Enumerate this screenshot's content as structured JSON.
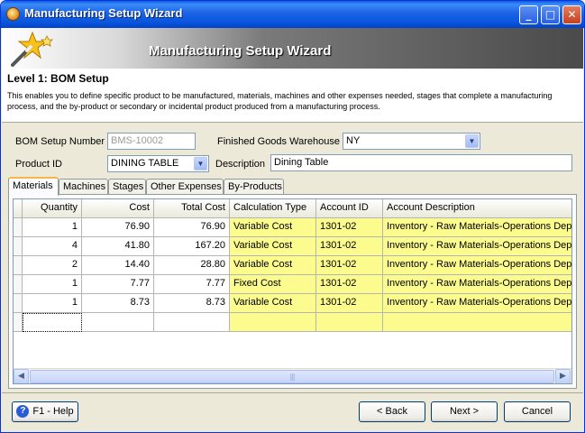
{
  "window": {
    "title": "Manufacturing Setup Wizard",
    "minimize": "_",
    "maximize": "□",
    "close": "✕"
  },
  "banner": {
    "title": "Manufacturing Setup Wizard",
    "icon": "magic-wand-icon"
  },
  "header": {
    "level_title": "Level 1: BOM Setup",
    "description": "This enables you to define specific product to be manufactured, materials, machines and other expenses needed, stages that complete a manufacturing process, and the by-product or secondary or incidental product produced from a manufacturing process."
  },
  "form": {
    "bom_setup_number_label": "BOM Setup Number",
    "bom_setup_number_value": "BMS-10002",
    "finished_goods_warehouse_label": "Finished Goods Warehouse",
    "finished_goods_warehouse_value": "NY",
    "product_id_label": "Product ID",
    "product_id_value": "DINING TABLE",
    "description_label": "Description",
    "description_value": "Dining Table"
  },
  "tabs": [
    {
      "label": "Materials",
      "active": true
    },
    {
      "label": "Machines"
    },
    {
      "label": "Stages"
    },
    {
      "label": "Other Expenses"
    },
    {
      "label": "By-Products"
    }
  ],
  "grid": {
    "columns": [
      "Quantity",
      "Cost",
      "Total Cost",
      "Calculation Type",
      "Account ID",
      "Account Description"
    ],
    "rows": [
      [
        "1",
        "76.90",
        "76.90",
        "Variable Cost",
        "1301-02",
        "Inventory - Raw Materials-Operations Depa"
      ],
      [
        "4",
        "41.80",
        "167.20",
        "Variable Cost",
        "1301-02",
        "Inventory - Raw Materials-Operations Depa"
      ],
      [
        "2",
        "14.40",
        "28.80",
        "Variable Cost",
        "1301-02",
        "Inventory - Raw Materials-Operations Depa"
      ],
      [
        "1",
        "7.77",
        "7.77",
        "Fixed Cost",
        "1301-02",
        "Inventory - Raw Materials-Operations Depa"
      ],
      [
        "1",
        "8.73",
        "8.73",
        "Variable Cost",
        "1301-02",
        "Inventory - Raw Materials-Operations Depa"
      ]
    ],
    "highlight_color": "#fbfb8e"
  },
  "buttons": {
    "help": "F1 - Help",
    "back": "< Back",
    "next": "Next >",
    "cancel": "Cancel"
  }
}
